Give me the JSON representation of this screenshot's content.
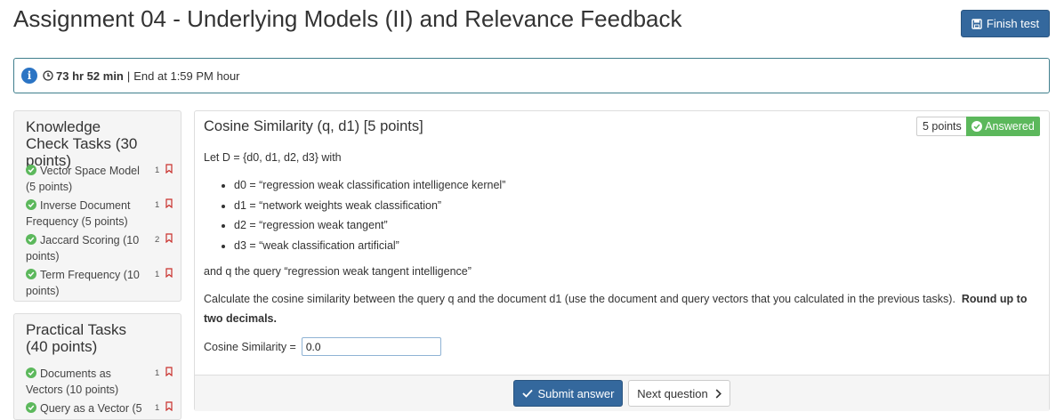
{
  "page": {
    "title": "Assignment 04 - Underlying Models (II) and Relevance Feedback",
    "finish_label": "Finish test"
  },
  "info": {
    "time_left": "73 hr 52 min",
    "separator": "|",
    "end_text": "End at 1:59 PM hour"
  },
  "knowledge": {
    "title": "Knowledge Check Tasks (30 points)",
    "items": [
      {
        "label": "Vector Space Model (5 points)",
        "points": "1"
      },
      {
        "label": "Inverse Document Frequency (5 points)",
        "points": "1"
      },
      {
        "label": "Jaccard Scoring (10 points)",
        "points": "2"
      },
      {
        "label": "Term Frequency (10 points)",
        "points": "1"
      }
    ]
  },
  "practical": {
    "title": "Practical Tasks (40 points)",
    "items": [
      {
        "label": "Documents as Vectors (10 points)",
        "points": "1"
      },
      {
        "label": "Query as a Vector (5",
        "points": "1"
      }
    ]
  },
  "question": {
    "title": "Cosine Similarity (q, d1) [5 points]",
    "points_label": "5 points",
    "answered_label": "Answered",
    "intro": "Let D = {d0, d1, d2, d3} with",
    "docs": [
      "d0 = “regression weak classification intelligence kernel”",
      "d1 = “network weights weak classification”",
      "d2 = “regression weak tangent”",
      "d3 = “weak classification artificial”"
    ],
    "query_line": "and q the query “regression weak tangent intelligence”",
    "instruction": "Calculate the cosine similarity between the query q and the document d1 (use the document and query vectors that you calculated in the previous tasks).",
    "instruction_bold": "Round up to two decimals.",
    "answer_label": "Cosine Similarity =",
    "answer_value": "0.0",
    "submit_label": "Submit answer",
    "next_label": "Next question"
  },
  "colors": {
    "primary": "#34689d",
    "success": "#5cb85c",
    "bookmark": "#c9302c",
    "info_border": "#3f7e8c"
  }
}
